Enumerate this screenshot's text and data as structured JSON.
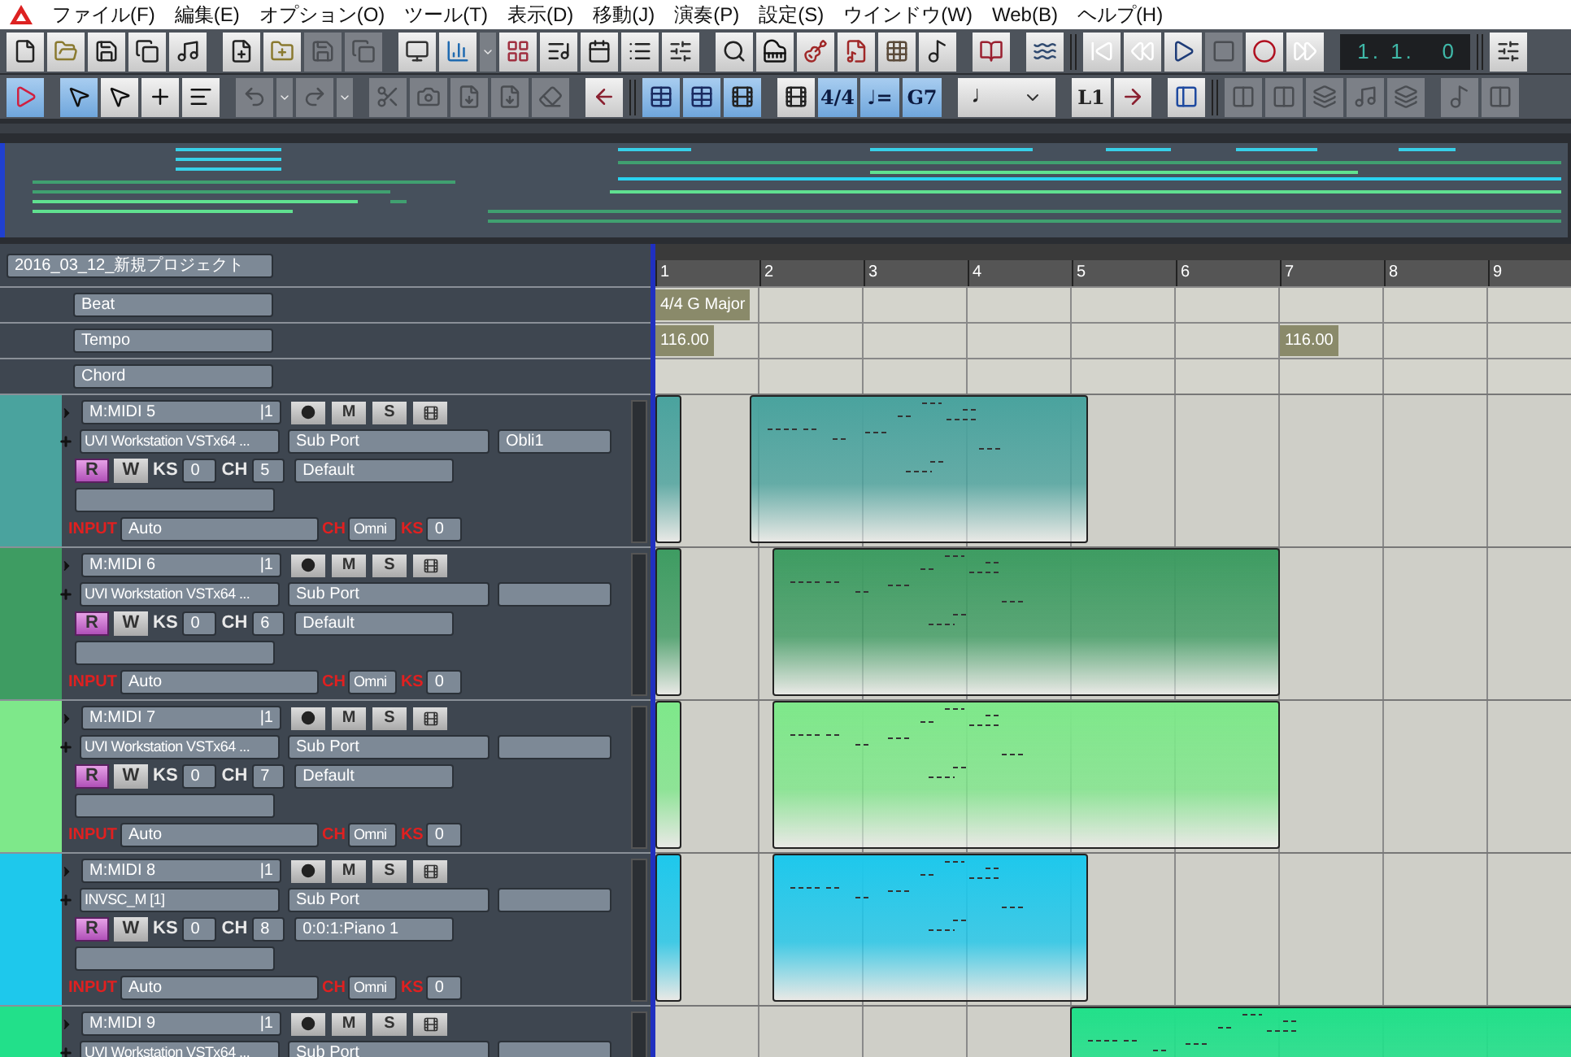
{
  "menu": [
    "ファイル(F)",
    "編集(E)",
    "オプション(O)",
    "ツール(T)",
    "表示(D)",
    "移動(J)",
    "演奏(P)",
    "設定(S)",
    "ウインドウ(W)",
    "Web(B)",
    "ヘルプ(H)"
  ],
  "toolbar1": [
    {
      "kind": "icon",
      "on": false,
      "disabled": false
    },
    {
      "kind": "icon",
      "on": false,
      "disabled": false
    },
    {
      "kind": "icon",
      "on": false,
      "disabled": false
    },
    {
      "kind": "icon",
      "on": false,
      "disabled": false
    },
    {
      "kind": "icon",
      "on": false,
      "disabled": false
    },
    {
      "kind": "gap"
    },
    {
      "kind": "icon",
      "on": false,
      "disabled": false
    },
    {
      "kind": "icon",
      "on": false,
      "disabled": false
    },
    {
      "kind": "icon",
      "on": false,
      "disabled": true
    },
    {
      "kind": "icon",
      "on": false,
      "disabled": true
    },
    {
      "kind": "gap"
    },
    {
      "kind": "icon",
      "on": false,
      "disabled": false
    },
    {
      "kind": "icon",
      "on": false,
      "disabled": false
    },
    {
      "kind": "dropdown"
    },
    {
      "kind": "icon",
      "on": false,
      "disabled": false
    },
    {
      "kind": "icon",
      "on": false,
      "disabled": false
    },
    {
      "kind": "icon",
      "on": false,
      "disabled": false
    },
    {
      "kind": "icon",
      "on": false,
      "disabled": false
    },
    {
      "kind": "icon",
      "on": false,
      "disabled": false
    },
    {
      "kind": "gap"
    },
    {
      "kind": "icon",
      "on": false,
      "disabled": false
    },
    {
      "kind": "icon",
      "on": false,
      "disabled": false
    },
    {
      "kind": "icon",
      "on": false,
      "disabled": false
    },
    {
      "kind": "icon",
      "on": false,
      "disabled": false
    },
    {
      "kind": "icon",
      "on": false,
      "disabled": false
    },
    {
      "kind": "icon",
      "on": false,
      "disabled": false
    },
    {
      "kind": "gap"
    },
    {
      "kind": "icon",
      "on": false,
      "disabled": false
    },
    {
      "kind": "gap"
    },
    {
      "kind": "icon",
      "on": false,
      "disabled": false
    },
    {
      "kind": "sep"
    },
    {
      "kind": "icon",
      "on": false,
      "disabled": false
    },
    {
      "kind": "icon",
      "on": false,
      "disabled": false
    },
    {
      "kind": "icon",
      "on": false,
      "disabled": false
    },
    {
      "kind": "icon",
      "on": false,
      "disabled": true
    },
    {
      "kind": "icon",
      "on": false,
      "disabled": false
    },
    {
      "kind": "icon",
      "on": false,
      "disabled": false
    },
    {
      "kind": "gap"
    },
    {
      "kind": "counter",
      "label": "1. 1.   0"
    },
    {
      "kind": "sep"
    },
    {
      "kind": "icon",
      "on": false,
      "disabled": false
    }
  ],
  "toolbar2": [
    {
      "kind": "icon",
      "on": true,
      "disabled": false
    },
    {
      "kind": "gap"
    },
    {
      "kind": "icon",
      "on": true,
      "disabled": false
    },
    {
      "kind": "icon",
      "on": false,
      "disabled": false
    },
    {
      "kind": "icon",
      "on": false,
      "disabled": false
    },
    {
      "kind": "icon",
      "on": false,
      "disabled": false
    },
    {
      "kind": "gap"
    },
    {
      "kind": "icon",
      "on": false,
      "disabled": true
    },
    {
      "kind": "dropdown"
    },
    {
      "kind": "icon",
      "on": false,
      "disabled": true
    },
    {
      "kind": "dropdown"
    },
    {
      "kind": "gap"
    },
    {
      "kind": "icon",
      "on": false,
      "disabled": true
    },
    {
      "kind": "icon",
      "on": false,
      "disabled": true
    },
    {
      "kind": "icon",
      "on": false,
      "disabled": true
    },
    {
      "kind": "icon",
      "on": false,
      "disabled": true
    },
    {
      "kind": "icon",
      "on": false,
      "disabled": true
    },
    {
      "kind": "gap"
    },
    {
      "kind": "icon",
      "on": false,
      "disabled": false
    },
    {
      "kind": "sep"
    },
    {
      "kind": "icon",
      "on": true,
      "disabled": false
    },
    {
      "kind": "icon",
      "on": true,
      "disabled": false
    },
    {
      "kind": "icon",
      "on": true,
      "disabled": false
    },
    {
      "kind": "gap"
    },
    {
      "kind": "icon",
      "on": false,
      "disabled": false
    },
    {
      "kind": "text",
      "label": "4/4",
      "on": true
    },
    {
      "kind": "text",
      "label": "♩=",
      "on": true
    },
    {
      "kind": "text",
      "label": "G7",
      "on": true
    },
    {
      "kind": "gap"
    },
    {
      "kind": "note-select",
      "label": "♩"
    },
    {
      "kind": "gap"
    },
    {
      "kind": "text",
      "label": "L1",
      "on": false
    },
    {
      "kind": "icon",
      "on": false,
      "disabled": false
    },
    {
      "kind": "gap"
    },
    {
      "kind": "icon",
      "on": false,
      "disabled": false
    },
    {
      "kind": "sep"
    },
    {
      "kind": "icon",
      "on": false,
      "disabled": true
    },
    {
      "kind": "icon",
      "on": false,
      "disabled": true
    },
    {
      "kind": "icon",
      "on": false,
      "disabled": true
    },
    {
      "kind": "icon",
      "on": false,
      "disabled": true
    },
    {
      "kind": "icon",
      "on": false,
      "disabled": true
    },
    {
      "kind": "gap"
    },
    {
      "kind": "icon",
      "on": false,
      "disabled": true
    },
    {
      "kind": "icon",
      "on": false,
      "disabled": true
    }
  ],
  "project": {
    "name": "2016_03_12_新規プロジェクト"
  },
  "ruler": [
    "1",
    "2",
    "3",
    "4",
    "5",
    "6",
    "7",
    "8",
    "9"
  ],
  "conductor": [
    {
      "label": "Beat",
      "markers": [
        "4/4 G Major"
      ]
    },
    {
      "label": "Tempo",
      "markers": [
        "116.00",
        "116.00"
      ]
    },
    {
      "label": "Chord"
    }
  ],
  "tracks": [
    {
      "name": "M:MIDI 5",
      "port_no": "|1",
      "color": "#4aa39e",
      "mute": "M",
      "solo": "S",
      "instrument": "UVI Workstation VSTx64 ...",
      "port": "Sub Port",
      "program_bank": "Obli1",
      "read": {
        "label": "R",
        "on": true
      },
      "write": {
        "label": "W",
        "on": false
      },
      "ks_label": "KS",
      "ks": "0",
      "ch_label": "CH",
      "ch": "5",
      "program": "Default",
      "input_label": "INPUT",
      "input": "Auto",
      "input_ch_label": "CH",
      "input_ch": "Omni",
      "input_ks_label": "KS",
      "input_ks": "0"
    },
    {
      "name": "M:MIDI 6",
      "port_no": "|1",
      "color": "#3e9c62",
      "mute": "M",
      "solo": "S",
      "instrument": "UVI Workstation VSTx64 ...",
      "port": "Sub Port",
      "read": {
        "label": "R",
        "on": true
      },
      "write": {
        "label": "W",
        "on": false
      },
      "ks_label": "KS",
      "ks": "0",
      "ch_label": "CH",
      "ch": "6",
      "program": "Default",
      "input_label": "INPUT",
      "input": "Auto",
      "input_ch_label": "CH",
      "input_ch": "Omni",
      "input_ks_label": "KS",
      "input_ks": "0"
    },
    {
      "name": "M:MIDI 7",
      "port_no": "|1",
      "color": "#7ee88a",
      "mute": "M",
      "solo": "S",
      "instrument": "UVI Workstation VSTx64 ...",
      "port": "Sub Port",
      "read": {
        "label": "R",
        "on": true
      },
      "write": {
        "label": "W",
        "on": false
      },
      "ks_label": "KS",
      "ks": "0",
      "ch_label": "CH",
      "ch": "7",
      "program": "Default",
      "input_label": "INPUT",
      "input": "Auto",
      "input_ch_label": "CH",
      "input_ch": "Omni",
      "input_ks_label": "KS",
      "input_ks": "0"
    },
    {
      "name": "M:MIDI 8",
      "port_no": "|1",
      "color": "#1ec8ec",
      "mute": "M",
      "solo": "S",
      "instrument": "INVSC_M [1]",
      "port": "Sub Port",
      "read": {
        "label": "R",
        "on": true
      },
      "write": {
        "label": "W",
        "on": false
      },
      "ks_label": "KS",
      "ks": "0",
      "ch_label": "CH",
      "ch": "8",
      "program": "0:0:1:Piano 1",
      "input_label": "INPUT",
      "input": "Auto",
      "input_ch_label": "CH",
      "input_ch": "Omni",
      "input_ks_label": "KS",
      "input_ks": "0"
    },
    {
      "name": "M:MIDI 9",
      "port_no": "|1",
      "color": "#22e08a",
      "mute": "M",
      "solo": "S",
      "instrument": "UVI Workstation VSTx64 ...",
      "port": "Sub Port"
    }
  ]
}
